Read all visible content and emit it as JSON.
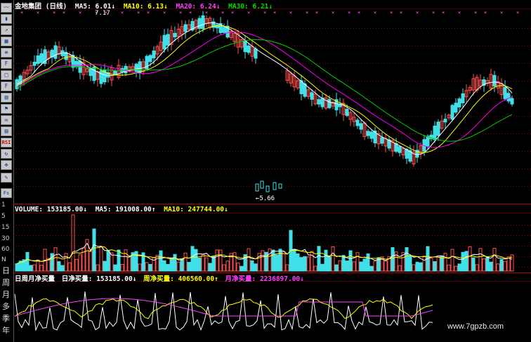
{
  "panel1": {
    "title": "金地集团 (日线)",
    "ma5": "MA5: 6.01↓",
    "ma10": "MA10: 6.13↓",
    "ma20": "MA20: 6.24↓",
    "ma30": "MA30: 6.21↓",
    "high_label": "7.17",
    "low_label": "5.66"
  },
  "panel2": {
    "volume": "VOLUME: 153185.00↓",
    "ma5": "MA5: 191008.00↑",
    "ma10": "MA10: 247744.00↓",
    "yticks": [
      "5",
      "15",
      "30",
      "60",
      "N"
    ]
  },
  "panel3": {
    "title": "日周月净买量",
    "day": "日净买量: 153185.00↓",
    "week": "周净买量: 406560.00↑",
    "month": "月净买量: 2236897.00↓"
  },
  "sidebar": {
    "numbers": [
      "1",
      "5",
      "15",
      "30",
      "60",
      "N"
    ],
    "periods": [
      "日",
      "周",
      "月",
      "多",
      "季",
      "年"
    ],
    "fs_label": "Fs",
    "rsi_label": "RSI"
  },
  "watermark": "www.7gpzb.com",
  "colors": {
    "up": "#ff5050",
    "down": "#40e0e8",
    "ma5": "#ffffff",
    "ma10": "#ffff00",
    "ma20": "#ff00ff",
    "ma30": "#00cc00",
    "title": "#ffffff",
    "week": "#ffff00",
    "month": "#ff40ff",
    "grid": "#8b0000"
  }
}
